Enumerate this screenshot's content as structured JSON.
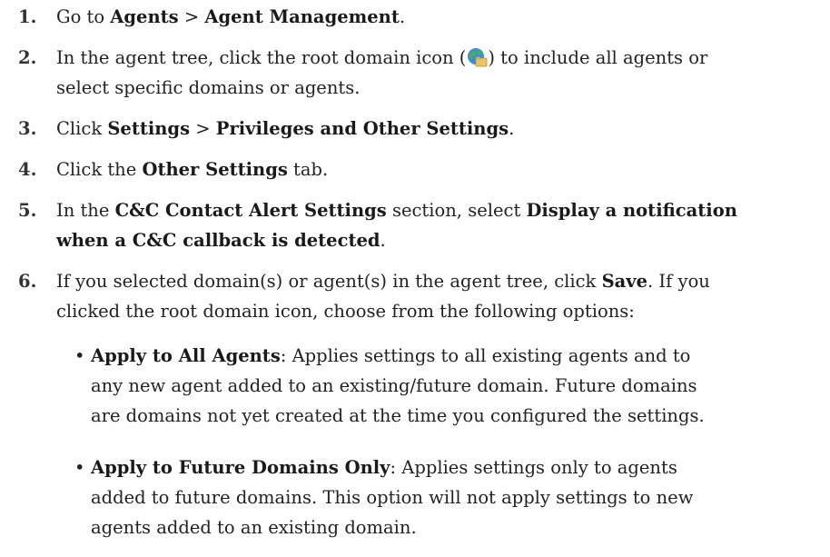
{
  "steps": [
    {
      "num": "1.",
      "parts": [
        "Go to ",
        "Agents",
        " > ",
        "Agent Management",
        "."
      ]
    },
    {
      "num": "2.",
      "line1a": "In the agent tree, click the root domain icon (",
      "line1b": ") to include all agents or",
      "line2": "select specific domains or agents."
    },
    {
      "num": "3.",
      "parts": [
        "Click ",
        "Settings",
        " > ",
        "Privileges and Other Settings",
        "."
      ]
    },
    {
      "num": "4.",
      "parts": [
        "Click the ",
        "Other Settings",
        " tab."
      ]
    },
    {
      "num": "5.",
      "a": "In the ",
      "b": "C&C Contact Alert Settings",
      "c": " section, select ",
      "d": "Display a notification",
      "e": "when a C&C callback is detected",
      "f": "."
    },
    {
      "num": "6.",
      "a": "If you selected domain(s) or agent(s) in the agent tree, click ",
      "b": "Save",
      "c": ". If you",
      "d": "clicked the root domain icon, choose from the following options:"
    }
  ],
  "options": [
    {
      "title": "Apply to All Agents",
      "line1": ": Applies settings to all existing agents and to",
      "line2": "any new agent added to an existing/future domain. Future domains",
      "line3": "are domains not yet created at the time you configured the settings."
    },
    {
      "title": "Apply to Future Domains Only",
      "line1": ": Applies settings only to agents",
      "line2": "added to future domains. This option will not apply settings to new",
      "line3": "agents added to an existing domain."
    }
  ],
  "icons": {
    "root_domain": "globe-folder-icon"
  },
  "colors": {
    "text": "#222222",
    "globe_blue": "#3b8fd6",
    "globe_green": "#4caf50",
    "folder": "#e9c46a"
  }
}
